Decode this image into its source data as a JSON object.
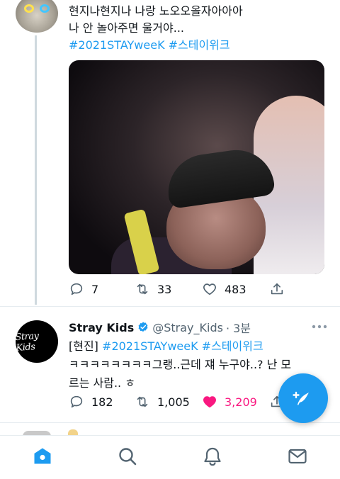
{
  "tweet1": {
    "lines": [
      "현지나현지나 나랑 노오오올자아아아",
      "나 안 놀아주면 울거야..."
    ],
    "hashtags": "#2021STAYweeK #스테이위크",
    "media_icon": "photo-crying-person",
    "stats": {
      "replies": "7",
      "retweets": "33",
      "likes": "483"
    }
  },
  "tweet2": {
    "author_name": "Stray Kids",
    "handle": "@Stray_Kids",
    "time": "· 3분",
    "avatar_logo": "Stray Kids",
    "prefix": "[현진]",
    "hashtags": "#2021STAYweeK #스테이위크",
    "line2": "ㅋㅋㅋㅋㅋㅋㅋㅋ그랭..근데 쟤 누구야..? 난 모",
    "line3": "르는 사람.. ㅎ",
    "stats": {
      "replies": "182",
      "retweets": "1,005",
      "likes": "3,209"
    },
    "liked": true
  },
  "colors": {
    "accent": "#1d9bf0",
    "like": "#f91880",
    "muted": "#536471"
  },
  "icons": {
    "reply": "reply-icon",
    "retweet": "retweet-icon",
    "like": "heart-icon",
    "share": "share-icon",
    "compose": "compose-quill-icon",
    "verified": "verified-badge-icon",
    "more": "more-dots-icon"
  },
  "nav": [
    "home",
    "explore",
    "notifications",
    "messages"
  ]
}
